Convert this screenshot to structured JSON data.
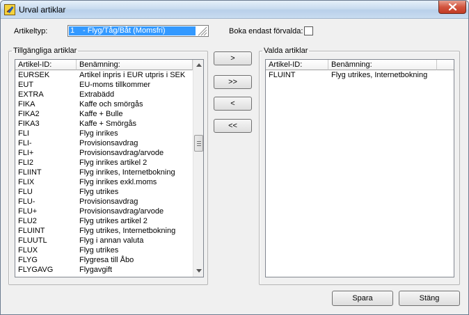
{
  "window": {
    "title": "Urval artiklar",
    "close_label": "Stäng fönster"
  },
  "form": {
    "artikeltyp_label": "Artikeltyp:",
    "artikeltyp_code": "1",
    "artikeltyp_value": "- Flyg/Tåg/Båt (Momsfri)",
    "boka_label": "Boka endast förvalda:",
    "boka_checked": false
  },
  "available": {
    "group_title": "Tillgängliga artiklar",
    "columns": [
      "Artikel-ID:",
      "Benämning:"
    ],
    "rows": [
      [
        "EURSEK",
        "Artikel inpris i EUR utpris i SEK"
      ],
      [
        "EUT",
        "EU-moms tillkommer"
      ],
      [
        "EXTRA",
        "Extrabädd"
      ],
      [
        "FIKA",
        "Kaffe och smörgås"
      ],
      [
        "FIKA2",
        "Kaffe + Bulle"
      ],
      [
        "FIKA3",
        "Kaffe + Smörgås"
      ],
      [
        "FLI",
        "Flyg inrikes"
      ],
      [
        "FLI-",
        "Provisionsavdrag"
      ],
      [
        "FLI+",
        "Provisionsavdrag/arvode"
      ],
      [
        "FLI2",
        "Flyg inrikes artikel 2"
      ],
      [
        "FLIINT",
        "Flyg inrikes, Internetbokning"
      ],
      [
        "FLIX",
        "Flyg inrikes exkl.moms"
      ],
      [
        "FLU",
        "Flyg utrikes"
      ],
      [
        "FLU-",
        "Provisionsavdrag"
      ],
      [
        "FLU+",
        "Provisionsavdrag/arvode"
      ],
      [
        "FLU2",
        "Flyg utrikes artikel 2"
      ],
      [
        "FLUINT",
        "Flyg utrikes, Internetbokning"
      ],
      [
        "FLUUTL",
        "Flyg i annan valuta"
      ],
      [
        "FLUX",
        "Flyg utrikes"
      ],
      [
        "FLYG",
        "Flygresa till Åbo"
      ],
      [
        "FLYGAVG",
        "Flygavgift"
      ]
    ]
  },
  "selected": {
    "group_title": "Valda artiklar",
    "columns": [
      "Artikel-ID:",
      "Benämning:"
    ],
    "rows": [
      [
        "FLUINT",
        "Flyg utrikes, Internetbokning"
      ]
    ]
  },
  "transfer_buttons": [
    ">",
    ">>",
    "<",
    "<<"
  ],
  "footer": {
    "save_label": "Spara",
    "close_label": "Stäng"
  }
}
